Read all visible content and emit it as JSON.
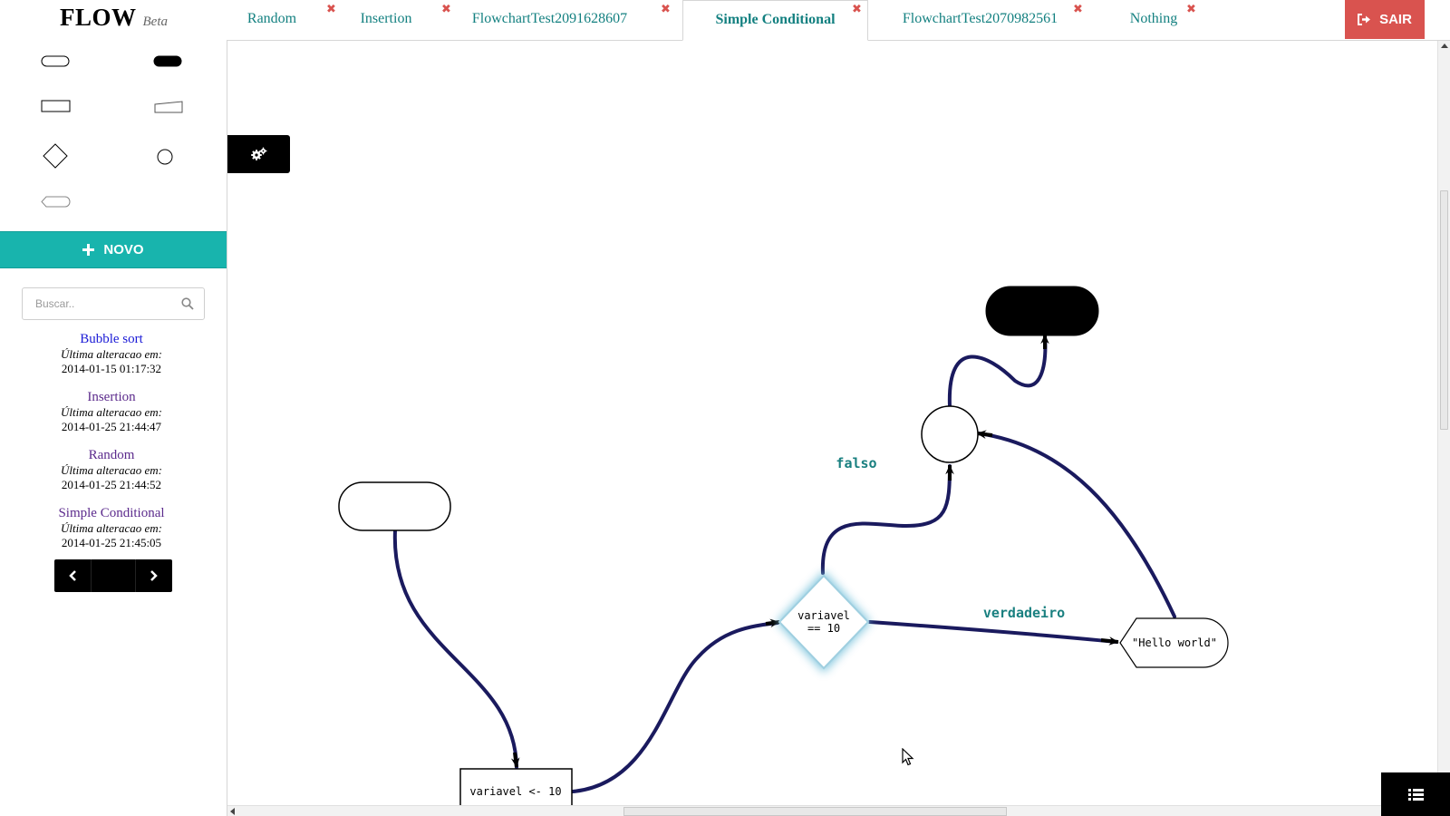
{
  "app": {
    "brand": "FLOW",
    "badge": "Beta"
  },
  "tabs": [
    {
      "label": "Random",
      "active": false
    },
    {
      "label": "Insertion",
      "active": false
    },
    {
      "label": "FlowchartTest2091628607",
      "active": false
    },
    {
      "label": "Simple Conditional",
      "active": true
    },
    {
      "label": "FlowchartTest2070982561",
      "active": false
    },
    {
      "label": "Nothing",
      "active": false
    }
  ],
  "tab_close_glyph": "✖",
  "logout": {
    "label": "SAIR",
    "icon": "sign-out-icon"
  },
  "palette": [
    {
      "name": "terminal-shape"
    },
    {
      "name": "terminal-filled-shape"
    },
    {
      "name": "process-shape"
    },
    {
      "name": "input-shape"
    },
    {
      "name": "decision-shape"
    },
    {
      "name": "connector-shape"
    },
    {
      "name": "display-shape"
    }
  ],
  "new_button": {
    "label": "NOVO",
    "icon": "plus-icon"
  },
  "search": {
    "placeholder": "Buscar..",
    "value": "",
    "icon": "search-icon"
  },
  "files": [
    {
      "name": "Bubble sort",
      "meta_label": "Última alteracao em:",
      "date": "2014-01-15 01:17:32"
    },
    {
      "name": "Insertion",
      "meta_label": "Última alteracao em:",
      "date": "2014-01-25 21:44:47"
    },
    {
      "name": "Random",
      "meta_label": "Última alteracao em:",
      "date": "2014-01-25 21:44:52"
    },
    {
      "name": "Simple Conditional",
      "meta_label": "Última alteracao em:",
      "date": "2014-01-25 21:45:05"
    }
  ],
  "pager": {
    "prev_icon": "chevron-left-icon",
    "next_icon": "chevron-right-icon"
  },
  "settings_button": {
    "icon": "gears-icon"
  },
  "console_button": {
    "icon": "list-icon"
  },
  "flowchart": {
    "nodes": {
      "start": {
        "type": "terminal",
        "text": ""
      },
      "assign": {
        "type": "process",
        "text": "variavel <- 10"
      },
      "decision": {
        "type": "decision",
        "line1": "variavel",
        "line2": "== 10",
        "selected": true
      },
      "output": {
        "type": "display",
        "text": "\"Hello world\""
      },
      "merge": {
        "type": "connector",
        "text": ""
      },
      "end": {
        "type": "terminal-filled",
        "text": ""
      }
    },
    "edge_labels": {
      "false_label": "falso",
      "true_label": "verdadeiro"
    },
    "colors": {
      "edge": "#1a1a5e",
      "selection_glow": "#7ac3dc",
      "label": "#1a8080"
    }
  },
  "colors": {
    "accent": "#18b4ad",
    "tab_text": "#138080",
    "danger": "#d9534f"
  }
}
